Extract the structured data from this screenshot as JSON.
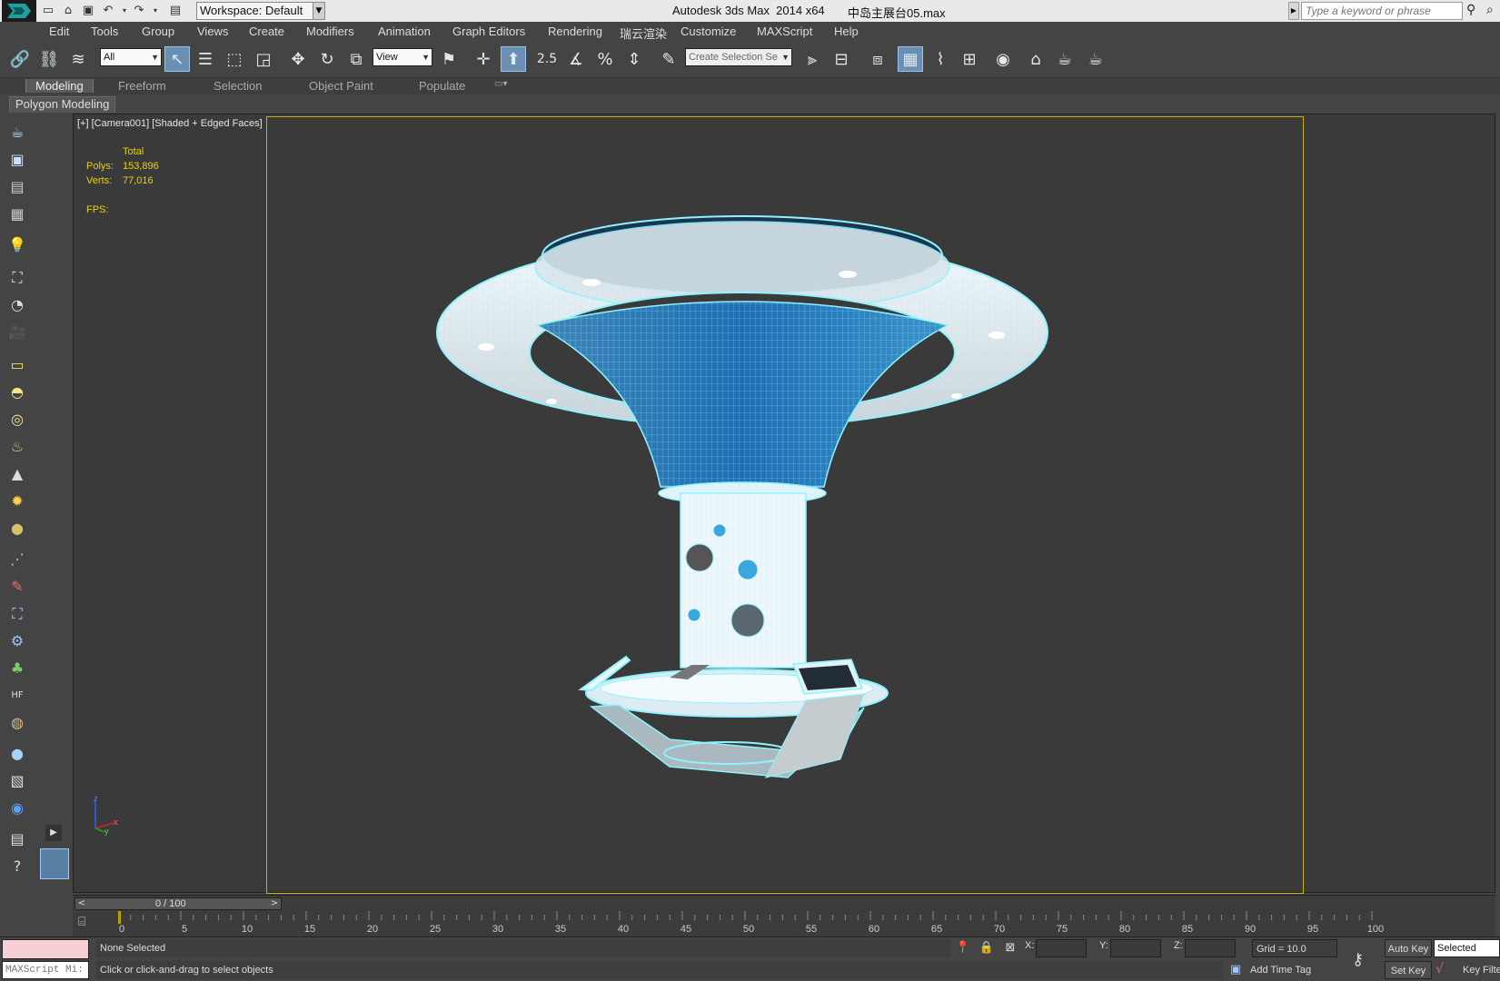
{
  "titlebar": {
    "workspace": "Workspace: Default",
    "window_title": "Autodesk 3ds Max  2014 x64",
    "file_title": "中岛主展台05.max",
    "search_placeholder": "Type a keyword or phrase"
  },
  "menu": [
    "Edit",
    "Tools",
    "Group",
    "Views",
    "Create",
    "Modifiers",
    "Animation",
    "Graph Editors",
    "Rendering",
    "瑞云渲染",
    "Customize",
    "MAXScript",
    "Help"
  ],
  "toolbar": {
    "selection_filter": "All",
    "reference_coord": "View",
    "snap_angle": "2.5",
    "named_selection_placeholder": "Create Selection Se"
  },
  "ribbon": {
    "tabs": [
      "Modeling",
      "Freeform",
      "Selection",
      "Object Paint",
      "Populate"
    ],
    "active_tab": "Modeling",
    "panel": "Polygon Modeling"
  },
  "viewport": {
    "label": "[+] [Camera001] [Shaded + Edged Faces]",
    "stats": {
      "header": "Total",
      "polys_label": "Polys:",
      "polys_value": "153,896",
      "verts_label": "Verts:",
      "verts_value": "77,016",
      "fps_label": "FPS:"
    },
    "axis_labels": {
      "z": "z",
      "x": "x",
      "y": "y"
    }
  },
  "timeline": {
    "frame": "0 / 100",
    "ticks": [
      "0",
      "5",
      "10",
      "15",
      "20",
      "25",
      "30",
      "35",
      "40",
      "45",
      "50",
      "55",
      "60",
      "65",
      "70",
      "75",
      "80",
      "85",
      "90",
      "95",
      "100"
    ]
  },
  "status": {
    "maxscript": "MAXScript Mi:",
    "selection": "None Selected",
    "prompt": "Click or click-and-drag to select objects",
    "x_label": "X:",
    "y_label": "Y:",
    "z_label": "Z:",
    "grid": "Grid = 10.0",
    "add_time_tag": "Add Time Tag",
    "auto_key": "Auto Key",
    "set_key": "Set Key",
    "selected": "Selected",
    "key_filters": "Key Filters..."
  },
  "colors": {
    "safe_frame": "#c8b400",
    "stats_text": "#f0d000",
    "wire": "#8ef3ff",
    "active_button": "#6a8fb5"
  }
}
